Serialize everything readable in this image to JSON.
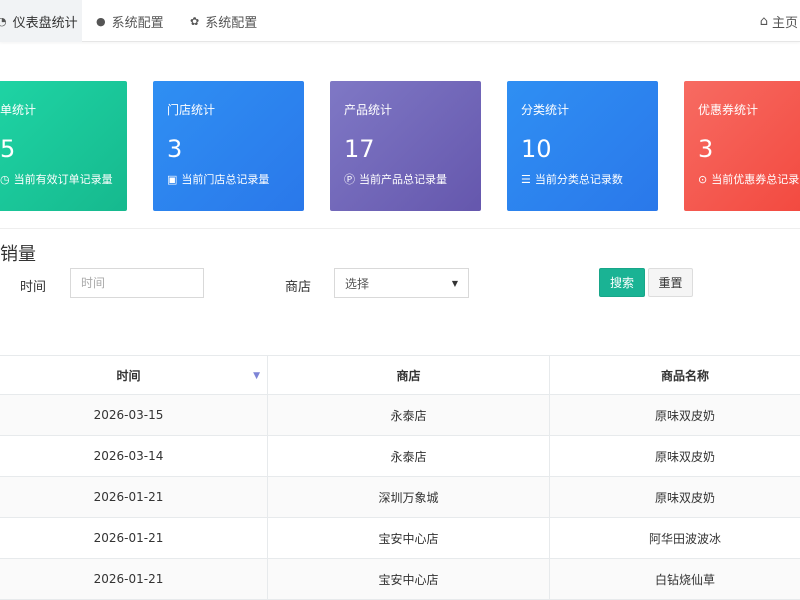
{
  "nav": {
    "tabs": [
      {
        "label": "仪表盘统计",
        "icon": "dashboard-icon"
      },
      {
        "label": "系统配置",
        "icon": "circle-icon"
      },
      {
        "label": "系统配置",
        "icon": "gear-icon"
      }
    ],
    "home_label": "主页"
  },
  "cards": [
    {
      "title": "单统计",
      "value": "5",
      "desc": "当前有效订单记录量",
      "icon": "clock-icon"
    },
    {
      "title": "门店统计",
      "value": "3",
      "desc": "当前门店总记录量",
      "icon": "shopping-bag-icon"
    },
    {
      "title": "产品统计",
      "value": "17",
      "desc": "当前产品总记录量",
      "icon": "product-p-icon"
    },
    {
      "title": "分类统计",
      "value": "10",
      "desc": "当前分类总记录数",
      "icon": "list-icon"
    },
    {
      "title": "优惠券统计",
      "value": "3",
      "desc": "当前优惠券总记录",
      "icon": "chevron-down-circle-icon"
    }
  ],
  "section": {
    "title": "品销量"
  },
  "filters": {
    "time_label": "时间",
    "time_placeholder": "时间",
    "store_label": "商店",
    "store_value": "选择",
    "search_label": "搜索",
    "reset_label": "重置"
  },
  "table": {
    "headers": [
      "时间",
      "商店",
      "商品名称"
    ],
    "rows": [
      [
        "2026-03-15",
        "永泰店",
        "原味双皮奶"
      ],
      [
        "2026-03-14",
        "永泰店",
        "原味双皮奶"
      ],
      [
        "2026-01-21",
        "深圳万象城",
        "原味双皮奶"
      ],
      [
        "2026-01-21",
        "宝安中心店",
        "阿华田波波冰"
      ],
      [
        "2026-01-21",
        "宝安中心店",
        "白钻烧仙草"
      ]
    ]
  },
  "colors": {
    "card_green": "#1fd6a6",
    "card_blue": "#2f8ff3",
    "card_purple": "#7f78c5",
    "card_red": "#f76b62",
    "search_button": "#1ab394"
  }
}
